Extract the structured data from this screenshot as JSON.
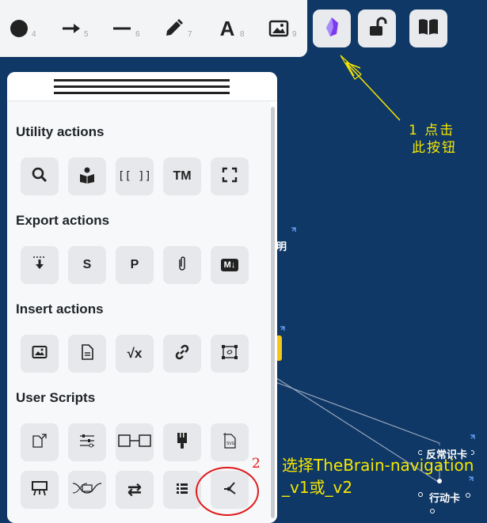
{
  "toolbar": {
    "tools": [
      {
        "icon": "circle-icon",
        "shortcut": "4"
      },
      {
        "icon": "arrow-right-icon",
        "shortcut": "5"
      },
      {
        "icon": "line-icon",
        "shortcut": "6"
      },
      {
        "icon": "pencil-icon",
        "shortcut": "7"
      },
      {
        "icon": "text-icon",
        "label": "A",
        "shortcut": "8"
      },
      {
        "icon": "image-icon",
        "shortcut": "9"
      }
    ],
    "buttons": [
      {
        "icon": "obsidian-crystal-icon"
      },
      {
        "icon": "unlock-icon"
      },
      {
        "icon": "book-open-icon"
      }
    ]
  },
  "panel": {
    "sections": [
      {
        "title": "Utility actions",
        "actions": [
          {
            "icon": "search-icon"
          },
          {
            "icon": "reading-person-icon"
          },
          {
            "icon": "brackets-icon",
            "label": "[[ ]]"
          },
          {
            "icon": "trademark-icon",
            "label": "TM"
          },
          {
            "icon": "fullscreen-icon"
          }
        ]
      },
      {
        "title": "Export actions",
        "actions": [
          {
            "icon": "download-icon"
          },
          {
            "icon": "save-icon",
            "label": "S"
          },
          {
            "icon": "png-icon",
            "label": "P"
          },
          {
            "icon": "attachment-icon"
          },
          {
            "icon": "markdown-icon",
            "label": "M↓"
          }
        ]
      },
      {
        "title": "Insert actions",
        "actions": [
          {
            "icon": "image-icon"
          },
          {
            "icon": "document-icon"
          },
          {
            "icon": "formula-icon",
            "label": "√x"
          },
          {
            "icon": "link-icon"
          },
          {
            "icon": "embed-icon"
          }
        ]
      },
      {
        "title": "User Scripts",
        "actions": [
          {
            "icon": "script-file-icon"
          },
          {
            "icon": "sliders-icon"
          },
          {
            "icon": "connect-boxes-icon"
          },
          {
            "icon": "brush-icon"
          },
          {
            "icon": "svg-file-icon"
          },
          {
            "icon": "presentation-icon"
          },
          {
            "icon": "curve-icon"
          },
          {
            "icon": "swap-icon",
            "label": "⇄"
          },
          {
            "icon": "list-icon"
          },
          {
            "icon": "thebrain-navigation-icon"
          }
        ]
      }
    ]
  },
  "graph": {
    "nodes": [
      {
        "label": "明"
      },
      {
        "label": "反常识卡"
      },
      {
        "label": "行动卡"
      }
    ]
  },
  "annotations": {
    "step1": "1 点击",
    "step1b": "此按钮",
    "step2_num": "2",
    "step2": "选择TheBrain-navigation",
    "step2b": "_v1或_v2"
  },
  "colors": {
    "background": "#0f3866",
    "annotation": "#f5e600",
    "circle": "#e0191c",
    "obsidian": "#7c3aed"
  }
}
